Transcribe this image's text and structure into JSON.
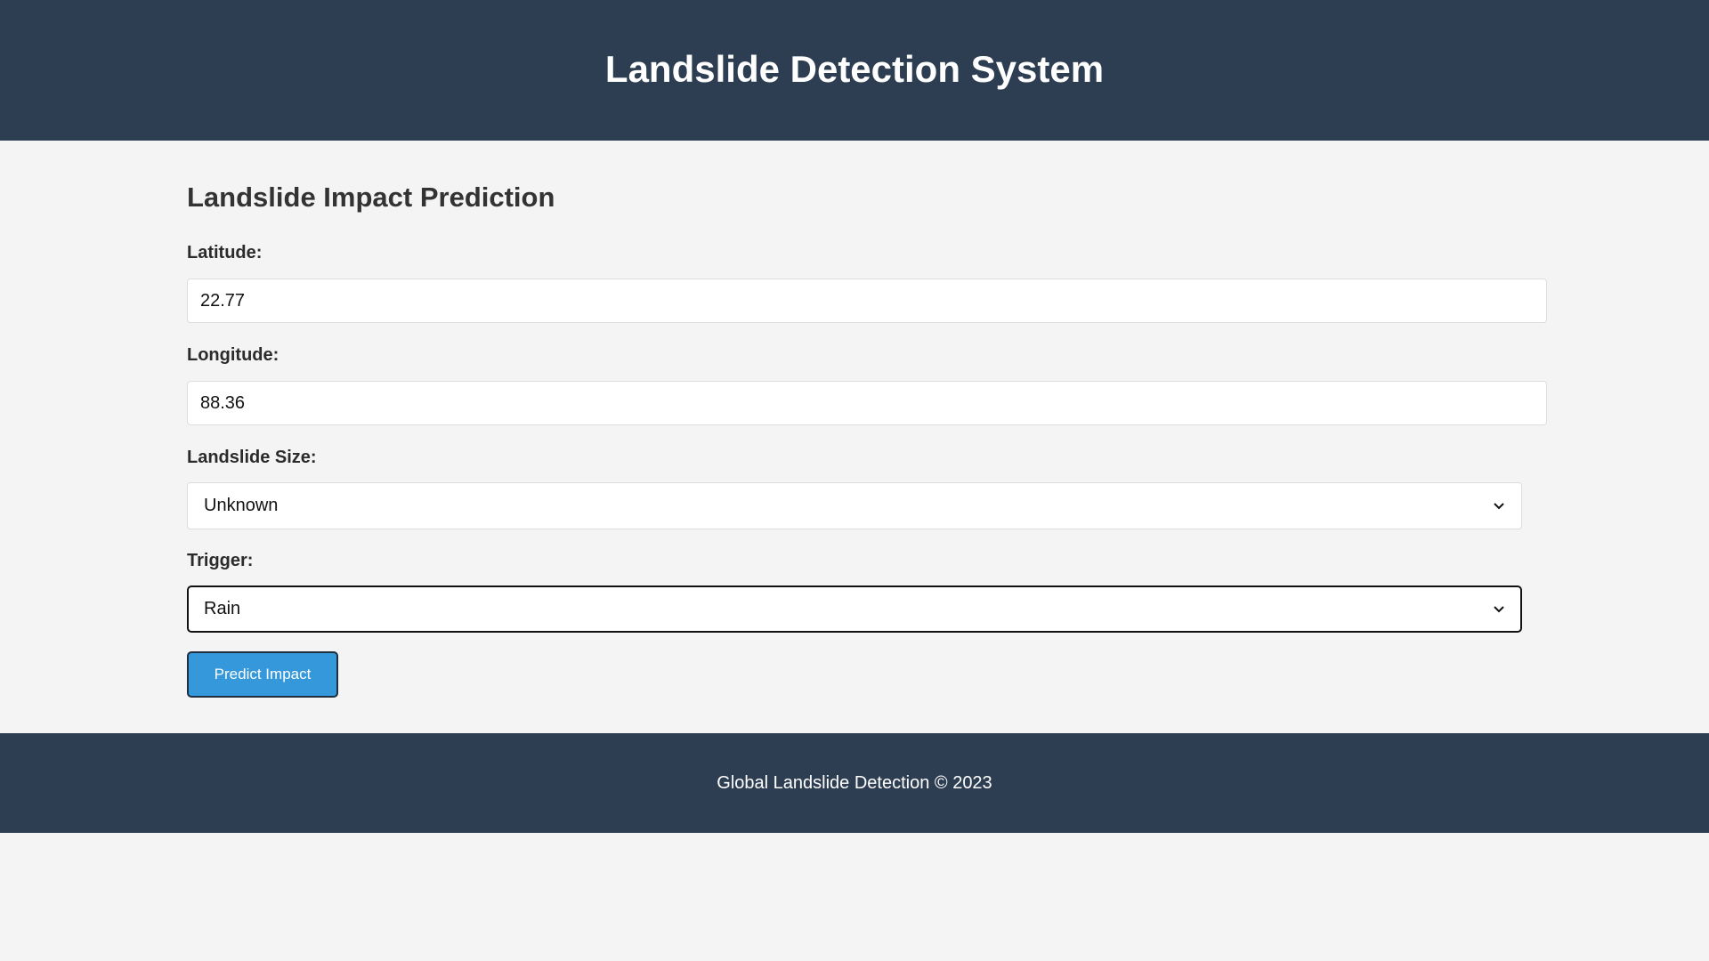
{
  "header": {
    "title": "Landslide Detection System"
  },
  "form": {
    "title": "Landslide Impact Prediction",
    "latitude": {
      "label": "Latitude:",
      "value": "22.77"
    },
    "longitude": {
      "label": "Longitude:",
      "value": "88.36"
    },
    "landslide_size": {
      "label": "Landslide Size:",
      "selected": "Unknown",
      "icon": "chevron-down-icon"
    },
    "trigger": {
      "label": "Trigger:",
      "selected": "Rain",
      "icon": "chevron-down-icon"
    },
    "submit_label": "Predict Impact"
  },
  "footer": {
    "text": "Global Landslide Detection © 2023"
  },
  "colors": {
    "header_bg": "#2e3e52",
    "page_bg": "#f4f4f4",
    "button_bg": "#3498db",
    "text": "#333333"
  }
}
